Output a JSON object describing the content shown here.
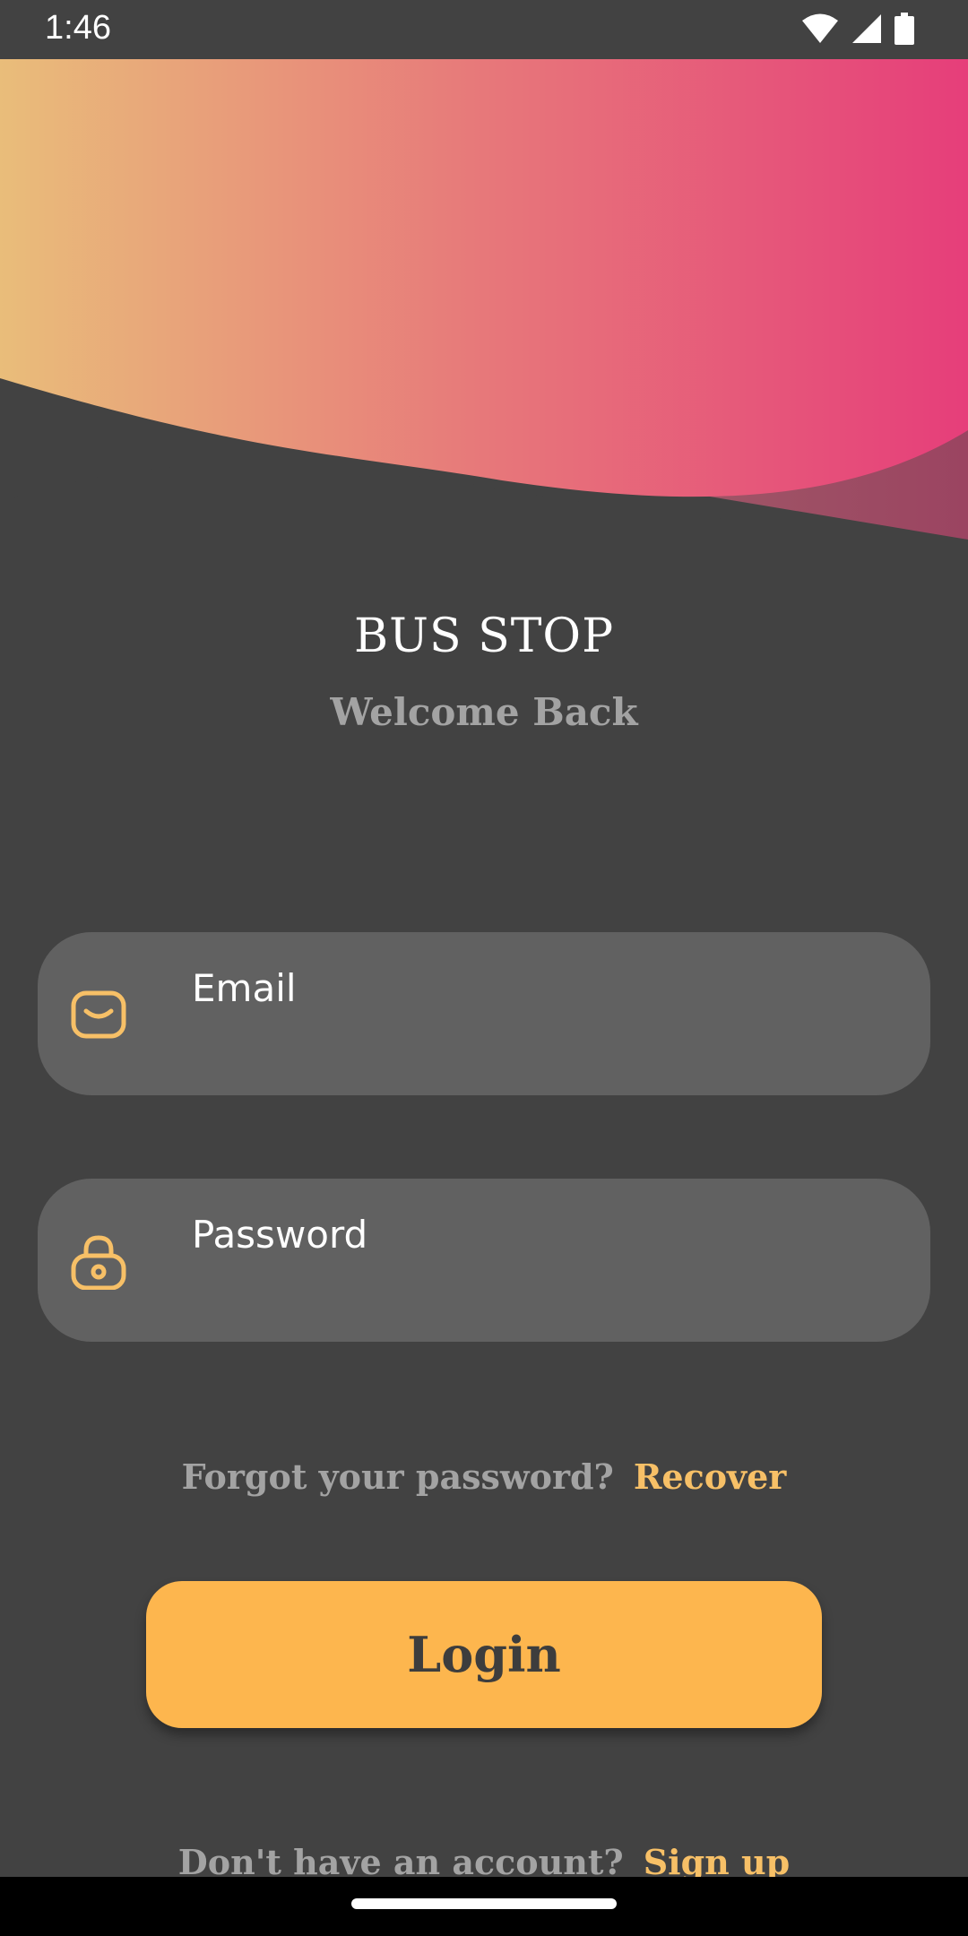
{
  "status_bar": {
    "time": "1:46"
  },
  "app": {
    "title": "BUS STOP",
    "subtitle": "Welcome Back"
  },
  "form": {
    "email_placeholder": "Email",
    "password_placeholder": "Password",
    "email_icon": "mail-icon",
    "password_icon": "lock-icon"
  },
  "recovery": {
    "prompt": "Forgot your password?",
    "link": "Recover"
  },
  "login_button": {
    "label": "Login"
  },
  "signup": {
    "prompt": "Don't have an account?",
    "link": "Sign up"
  },
  "colors": {
    "background": "#424242",
    "field": "#616161",
    "accent": "#fdb64e",
    "link": "#f7c067",
    "gradient_start": "#e9bd7a",
    "gradient_end": "#e63e7a"
  }
}
